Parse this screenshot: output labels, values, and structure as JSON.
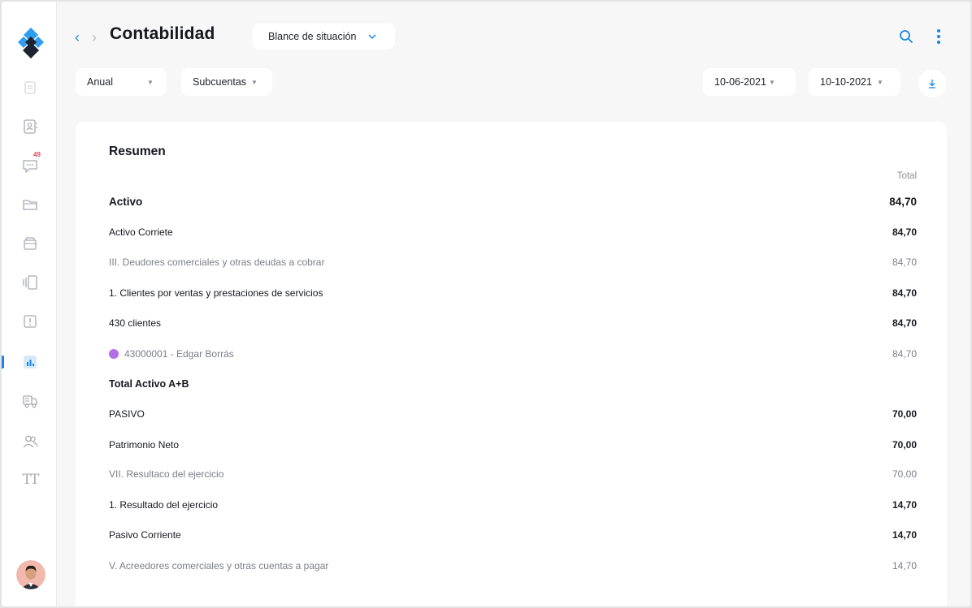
{
  "app": {
    "title": "Contabilidad",
    "report_selector": "Blance de situación",
    "accent_color": "#1a84e6"
  },
  "filters": {
    "period": "Anual",
    "accounts": "Subcuentas",
    "date_from": "10-06-2021",
    "date_to": "10-10-2021"
  },
  "sidebar": {
    "items": [
      {
        "icon": "document-icon"
      },
      {
        "icon": "contacts-icon"
      },
      {
        "icon": "chat-icon",
        "badge": "49"
      },
      {
        "icon": "folder-icon"
      },
      {
        "icon": "box-icon"
      },
      {
        "icon": "cards-icon"
      },
      {
        "icon": "alert-icon"
      },
      {
        "icon": "chart-icon",
        "active": true
      },
      {
        "icon": "truck-icon"
      },
      {
        "icon": "users-icon"
      },
      {
        "icon": "text-icon",
        "label": "TT"
      }
    ]
  },
  "summary": {
    "title": "Resumen",
    "column_header": "Total",
    "rows": [
      {
        "label": "Activo",
        "amount": "84,70",
        "style": "lg"
      },
      {
        "label": "Activo Corriete",
        "amount": "84,70",
        "style": "md bold"
      },
      {
        "label": "III. Deudores comerciales y otras deudas a cobrar",
        "amount": "84,70",
        "style": "md muted"
      },
      {
        "label": "1. Clientes por ventas y prestaciones de servicios",
        "amount": "84,70",
        "style": "md bold"
      },
      {
        "label": "430 clientes",
        "amount": "84,70",
        "style": "md bold"
      },
      {
        "label": "43000001 - Edgar Borrás",
        "amount": "84,70",
        "style": "md muted",
        "dot_color": "#b36ee8"
      },
      {
        "label": "Total Activo A+B",
        "amount": "",
        "style": "lg"
      },
      {
        "label": "PASIVO",
        "amount": "70,00",
        "style": "md bold"
      },
      {
        "label": "Patrimonio Neto",
        "amount": "70,00",
        "style": "md bold"
      },
      {
        "label": "VII. Resultaco del ejercicio",
        "amount": "70,00",
        "style": "md muted"
      },
      {
        "label": "1. Resultado del ejercicio",
        "amount": "14,70",
        "style": "md bold"
      },
      {
        "label": "Pasivo Corriente",
        "amount": "14,70",
        "style": "md bold"
      },
      {
        "label": "V. Acreedores comerciales y otras cuentas a pagar",
        "amount": "14,70",
        "style": "md muted"
      }
    ]
  }
}
